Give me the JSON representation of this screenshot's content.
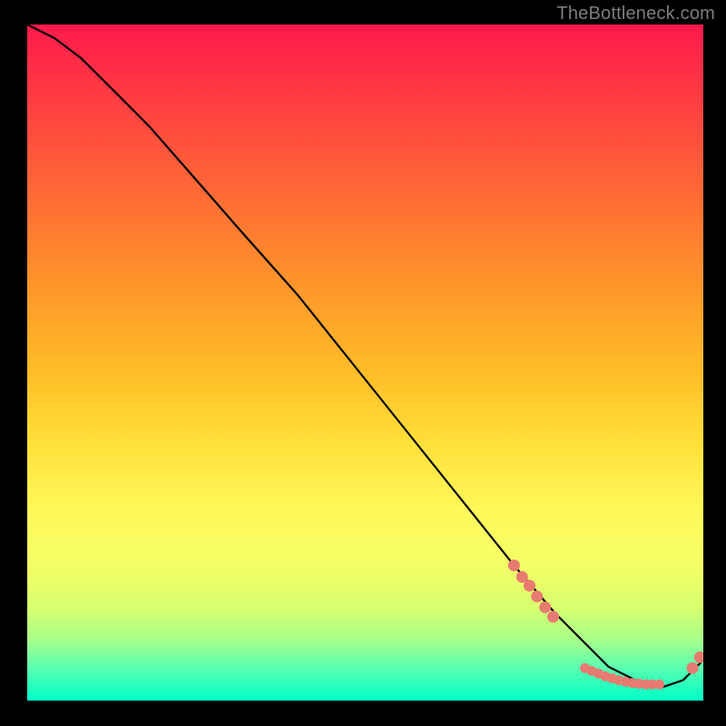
{
  "watermark": "TheBottleneck.com",
  "chart_data": {
    "type": "line",
    "title": "",
    "xlabel": "",
    "ylabel": "",
    "xlim": [
      0,
      100
    ],
    "ylim": [
      0,
      100
    ],
    "series": [
      {
        "name": "curve",
        "x": [
          0,
          4,
          8,
          12,
          18,
          25,
          32,
          40,
          48,
          56,
          64,
          72,
          78,
          82,
          86,
          90,
          94,
          97,
          100
        ],
        "y": [
          100,
          98,
          95,
          91,
          85,
          77,
          69,
          60,
          50,
          40,
          30,
          20,
          13,
          9,
          5,
          3,
          2,
          3,
          6
        ]
      }
    ],
    "scatter_groups": [
      {
        "name": "upper-dots",
        "points_xy": [
          [
            72.0,
            20.0
          ],
          [
            73.2,
            18.3
          ],
          [
            74.3,
            17.0
          ],
          [
            75.4,
            15.4
          ],
          [
            76.6,
            13.8
          ],
          [
            77.8,
            12.4
          ]
        ],
        "radius": 6
      },
      {
        "name": "trough-dots",
        "points_xy": [
          [
            82.5,
            4.8
          ],
          [
            83.5,
            4.4
          ],
          [
            84.5,
            4.0
          ],
          [
            85.5,
            3.6
          ],
          [
            86.5,
            3.3
          ],
          [
            87.5,
            3.0
          ],
          [
            88.5,
            2.8
          ],
          [
            89.5,
            2.6
          ],
          [
            90.5,
            2.5
          ],
          [
            91.5,
            2.4
          ],
          [
            92.5,
            2.4
          ],
          [
            93.5,
            2.4
          ]
        ],
        "radius": 5
      },
      {
        "name": "right-tail-dots",
        "points_xy": [
          [
            98.4,
            4.8
          ],
          [
            99.5,
            6.4
          ]
        ],
        "radius": 6
      }
    ],
    "background_gradient": {
      "top": "#ff1a4d",
      "mid_upper": "#ff9a2a",
      "mid": "#fff95a",
      "mid_lower": "#a8ff8a",
      "bottom": "#00ffc8"
    }
  }
}
